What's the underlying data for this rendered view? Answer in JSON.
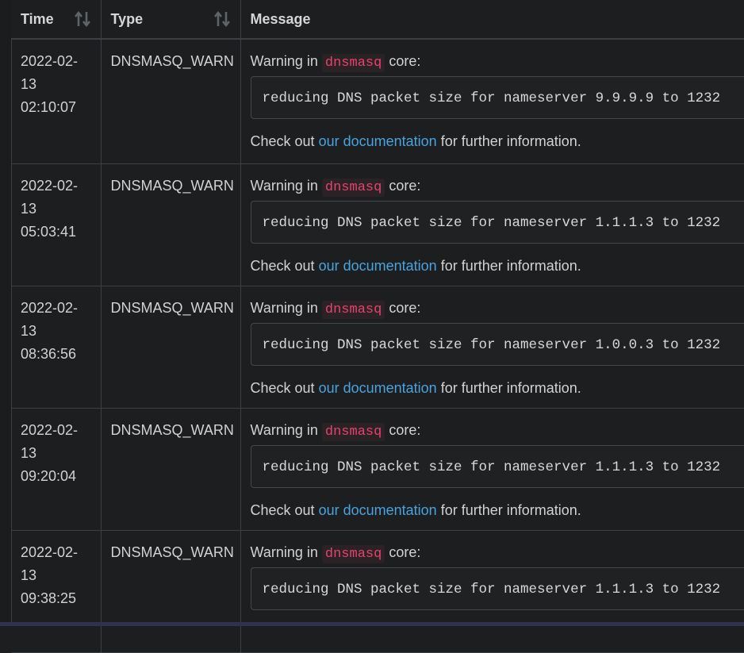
{
  "columns": {
    "time": "Time",
    "type": "Type",
    "message": "Message"
  },
  "icons": {
    "sort": "sort-arrows-icon"
  },
  "common": {
    "warning_prefix": "Warning in",
    "warning_code": "dnsmasq",
    "warning_suffix": "core:",
    "check_prefix": "Check out",
    "link_our": "our",
    "link_documentation": "documentation",
    "check_suffix": "for further information."
  },
  "rows": [
    {
      "date": "2022-02-",
      "day": "13",
      "time": "02:10:07",
      "type": "DNSMASQ_WARN",
      "detail": "reducing DNS packet size for nameserver 9.9.9.9 to 1232"
    },
    {
      "date": "2022-02-",
      "day": "13",
      "time": "05:03:41",
      "type": "DNSMASQ_WARN",
      "detail": "reducing DNS packet size for nameserver 1.1.1.3 to 1232"
    },
    {
      "date": "2022-02-",
      "day": "13",
      "time": "08:36:56",
      "type": "DNSMASQ_WARN",
      "detail": "reducing DNS packet size for nameserver 1.0.0.3 to 1232"
    },
    {
      "date": "2022-02-",
      "day": "13",
      "time": "09:20:04",
      "type": "DNSMASQ_WARN",
      "detail": "reducing DNS packet size for nameserver 1.1.1.3 to 1232"
    },
    {
      "date": "2022-02-",
      "day": "13",
      "time": "09:38:25",
      "type": "DNSMASQ_WARN",
      "detail": "reducing DNS packet size for nameserver 1.1.1.3 to 1232"
    }
  ],
  "colors": {
    "background": "#1c1e20",
    "border": "#3c4044",
    "code": "#e6436e",
    "link": "#4aa3df"
  }
}
